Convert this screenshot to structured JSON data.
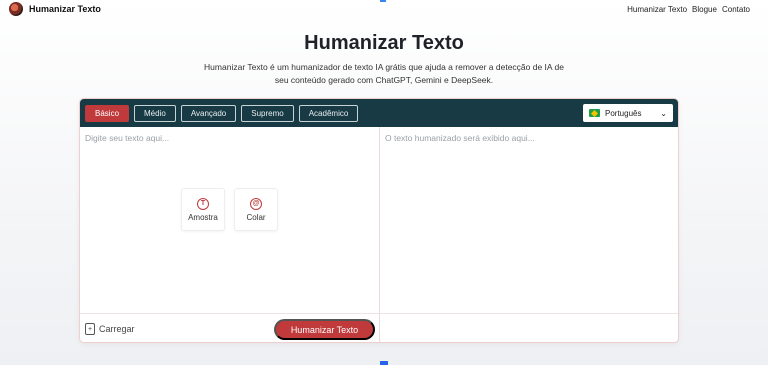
{
  "nav": {
    "brand": "Humanizar Texto",
    "links": [
      "Humanizar Texto",
      "Blogue",
      "Contato"
    ]
  },
  "hero": {
    "title": "Humanizar Texto",
    "subtitle_line1": "Humanizar Texto é um humanizador de texto IA grátis que ajuda a remover a detecção de IA de",
    "subtitle_line2": "seu conteúdo gerado com ChatGPT, Gemini e DeepSeek."
  },
  "toolbar": {
    "modes": [
      "Básico",
      "Médio",
      "Avançado",
      "Supremo",
      "Acadêmico"
    ],
    "active_mode": "Básico",
    "language": "Português"
  },
  "editor": {
    "input_placeholder": "Digite seu texto aqui...",
    "output_placeholder": "O texto humanizado será exibido aqui...",
    "sample_label": "Amostra",
    "paste_label": "Colar",
    "upload_label": "Carregar",
    "humanize_label": "Humanizar Texto"
  },
  "colors": {
    "accent": "#c0393b",
    "toolbar_bg": "#183a44"
  },
  "icons": {
    "brand": "logo-icon",
    "sample": "sample-icon",
    "paste": "paste-icon",
    "upload": "upload-icon",
    "chevron": "chevron-down-icon",
    "flag": "brazil-flag-icon"
  }
}
